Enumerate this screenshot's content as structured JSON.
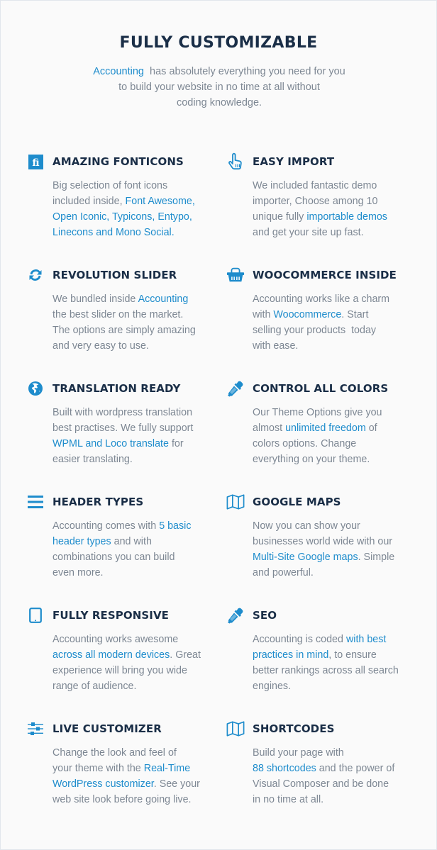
{
  "header": {
    "title": "FULLY CUSTOMIZABLE",
    "subtitle_link": "Accounting",
    "subtitle_line1": "  has absolutely everything you need for you",
    "subtitle_line2": "to build your website in no time at all without",
    "subtitle_line3": "coding knowledge."
  },
  "colors": {
    "accent": "#1e8ccc",
    "heading": "#1a2e47",
    "body_text": "#7d8793",
    "background": "#fafafa"
  },
  "features": [
    {
      "icon": "fonticons-icon",
      "title": "AMAZING FONTICONS",
      "lines": [
        [
          {
            "t": "Big selection of font icons"
          }
        ],
        [
          {
            "t": "included inside, "
          },
          {
            "t": "Font Awesome,",
            "link": true
          }
        ],
        [
          {
            "t": "Open Iconic, Typicons, Entypo,",
            "link": true
          }
        ],
        [
          {
            "t": "Linecons and Mono Social.",
            "link": true
          }
        ]
      ]
    },
    {
      "icon": "hand-pointer-icon",
      "title": "EASY IMPORT",
      "lines": [
        [
          {
            "t": "We included fantastic demo"
          }
        ],
        [
          {
            "t": "importer, Choose among 10"
          }
        ],
        [
          {
            "t": "unique fully "
          },
          {
            "t": "importable demos",
            "link": true
          }
        ],
        [
          {
            "t": "and get your site up fast."
          }
        ]
      ]
    },
    {
      "icon": "refresh-icon",
      "title": "REVOLUTION SLIDER",
      "lines": [
        [
          {
            "t": "We bundled inside "
          },
          {
            "t": "Accounting",
            "link": true
          }
        ],
        [
          {
            "t": "the best slider on the market."
          }
        ],
        [
          {
            "t": "The options are simply amazing"
          }
        ],
        [
          {
            "t": "and very easy to use."
          }
        ]
      ]
    },
    {
      "icon": "shopping-basket-icon",
      "title": "WOOCOMMERCE INSIDE",
      "lines": [
        [
          {
            "t": "Accounting works like a charm"
          }
        ],
        [
          {
            "t": "with "
          },
          {
            "t": "Woocommerce",
            "link": true
          },
          {
            "t": ". Start"
          }
        ],
        [
          {
            "t": "selling your products  today"
          }
        ],
        [
          {
            "t": "with ease."
          }
        ]
      ]
    },
    {
      "icon": "globe-icon",
      "title": "TRANSLATION READY",
      "lines": [
        [
          {
            "t": "Built with wordpress translation"
          }
        ],
        [
          {
            "t": "best practises. We fully support"
          }
        ],
        [
          {
            "t": "WPML and Loco translate",
            "link": true
          },
          {
            "t": " for"
          }
        ],
        [
          {
            "t": "easier translating."
          }
        ]
      ]
    },
    {
      "icon": "eyedropper-icon",
      "title": "CONTROL ALL COLORS",
      "lines": [
        [
          {
            "t": "Our Theme Options give you"
          }
        ],
        [
          {
            "t": "almost "
          },
          {
            "t": "unlimited freedom",
            "link": true
          },
          {
            "t": " of"
          }
        ],
        [
          {
            "t": "colors options. Change"
          }
        ],
        [
          {
            "t": "everything on your theme."
          }
        ]
      ]
    },
    {
      "icon": "menu-bars-icon",
      "title": "HEADER TYPES",
      "lines": [
        [
          {
            "t": "Accounting comes with "
          },
          {
            "t": "5 basic",
            "link": true
          }
        ],
        [
          {
            "t": "header types",
            "link": true
          },
          {
            "t": " and with"
          }
        ],
        [
          {
            "t": "combinations you can build"
          }
        ],
        [
          {
            "t": "even more."
          }
        ]
      ]
    },
    {
      "icon": "map-icon",
      "title": "GOOGLE MAPS",
      "lines": [
        [
          {
            "t": "Now you can show your"
          }
        ],
        [
          {
            "t": "businesses world wide with our"
          }
        ],
        [
          {
            "t": "Multi-Site Google maps",
            "link": true
          },
          {
            "t": ". Simple"
          }
        ],
        [
          {
            "t": "and powerful."
          }
        ]
      ]
    },
    {
      "icon": "tablet-icon",
      "title": "FULLY RESPONSIVE",
      "lines": [
        [
          {
            "t": "Accounting works awesome"
          }
        ],
        [
          {
            "t": "across all modern devices",
            "link": true
          },
          {
            "t": ". Great"
          }
        ],
        [
          {
            "t": "experience will bring you wide"
          }
        ],
        [
          {
            "t": "range of audience."
          }
        ]
      ]
    },
    {
      "icon": "eyedropper-icon",
      "title": "SEO",
      "lines": [
        [
          {
            "t": "Accounting is coded "
          },
          {
            "t": "with best",
            "link": true
          }
        ],
        [
          {
            "t": "practices in mind",
            "link": true
          },
          {
            "t": ", to ensure"
          }
        ],
        [
          {
            "t": "better rankings across all search"
          }
        ],
        [
          {
            "t": "engines."
          }
        ]
      ]
    },
    {
      "icon": "sliders-icon",
      "title": "LIVE CUSTOMIZER",
      "lines": [
        [
          {
            "t": "Change the look and feel of"
          }
        ],
        [
          {
            "t": "your theme with the "
          },
          {
            "t": "Real-Time",
            "link": true
          }
        ],
        [
          {
            "t": "WordPress customizer",
            "link": true
          },
          {
            "t": ". See your"
          }
        ],
        [
          {
            "t": "web site look before going live."
          }
        ]
      ]
    },
    {
      "icon": "map-icon",
      "title": "SHORTCODES",
      "lines": [
        [
          {
            "t": "Build your page with"
          }
        ],
        [
          {
            "t": "88 shortcodes",
            "link": true
          },
          {
            "t": " and the power of"
          }
        ],
        [
          {
            "t": "Visual Composer and be done"
          }
        ],
        [
          {
            "t": "in no time at all."
          }
        ]
      ]
    }
  ]
}
